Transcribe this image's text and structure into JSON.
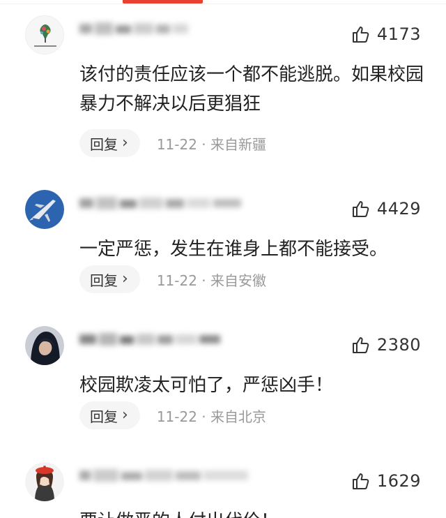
{
  "colors": {
    "accent": "#e8412f",
    "meta_text": "#999999",
    "reply_bg": "#f5f5f5"
  },
  "reply_label": "回复",
  "comments": [
    {
      "avatar": "avatar-floral-logo",
      "likes": "4173",
      "text": "该付的责任应该一个都不能逃脱。如果校园暴力不解决以后更猖狂",
      "date": "11-22",
      "location": "来自新疆"
    },
    {
      "avatar": "avatar-jet-plane",
      "likes": "4429",
      "text": "一定严惩，发生在谁身上都不能接受。",
      "date": "11-22",
      "location": "来自安徽"
    },
    {
      "avatar": "avatar-dark-hair",
      "likes": "2380",
      "text": "校园欺凌太可怕了，严惩凶手！",
      "date": "11-22",
      "location": "来自北京"
    },
    {
      "avatar": "avatar-girl-red-beret",
      "likes": "1629",
      "text": "要让做恶的人付出代价！",
      "date": "",
      "location": ""
    }
  ]
}
